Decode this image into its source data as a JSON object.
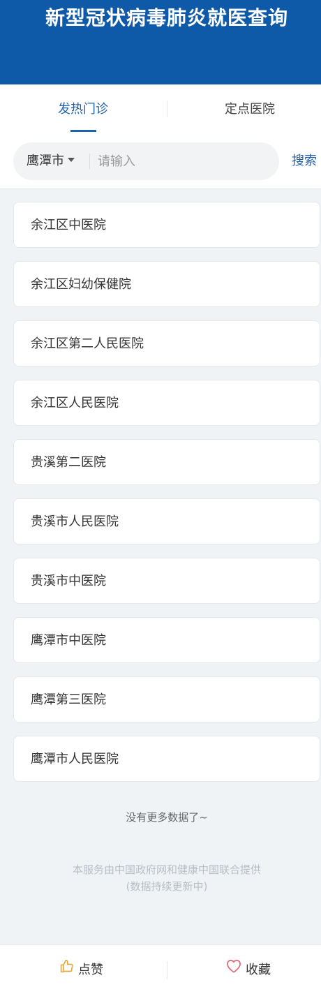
{
  "header": {
    "title": "新型冠状病毒肺炎就医查询"
  },
  "tabs": [
    {
      "label": "发热门诊",
      "active": true
    },
    {
      "label": "定点医院",
      "active": false
    }
  ],
  "search": {
    "city": "鹰潭市",
    "placeholder": "请输入",
    "value": "",
    "button_label": "搜索"
  },
  "hospitals": [
    "余江区中医院",
    "余江区妇幼保健院",
    "余江区第二人民医院",
    "余江区人民医院",
    "贵溪第二医院",
    "贵溪市人民医院",
    "贵溪市中医院",
    "鹰潭市中医院",
    "鹰潭第三医院",
    "鹰潭市人民医院"
  ],
  "list_end_text": "没有更多数据了~",
  "footer": {
    "line1": "本服务由中国政府网和健康中国联合提供",
    "line2": "(数据持续更新中)"
  },
  "bottom_bar": {
    "like_label": "点赞",
    "favorite_label": "收藏"
  },
  "colors": {
    "header_bg": "#0f5aa8",
    "accent": "#1f63ad",
    "like_icon": "#e8a83a",
    "favorite_icon": "#e0707a"
  },
  "icons": {
    "like": "thumbs-up-icon",
    "favorite": "heart-icon",
    "dropdown": "caret-down-icon"
  }
}
